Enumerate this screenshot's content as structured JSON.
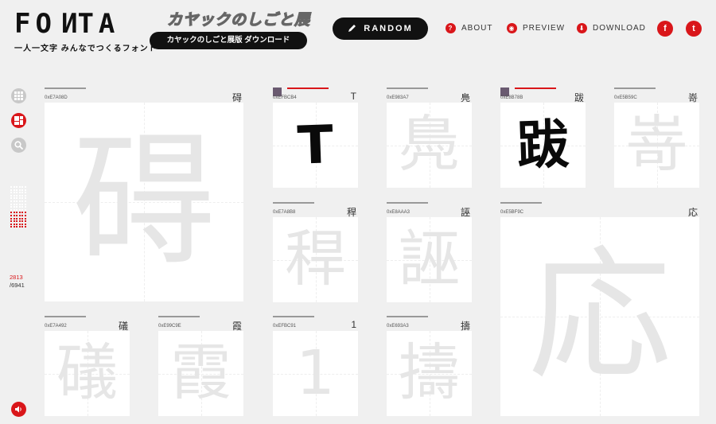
{
  "header": {
    "logo": "FONTA",
    "tagline": "一人一文字 みんなでつくるフォント",
    "event_title": "カヤックのしごと展",
    "event_button": "カヤックのしごと展版 ダウンロード",
    "random_label": "RANDOM",
    "random_icon": "pencil-icon",
    "nav": [
      {
        "label": "ABOUT",
        "icon": "question-icon",
        "glyph": "?"
      },
      {
        "label": "PREVIEW",
        "icon": "eye-icon",
        "glyph": "◉"
      },
      {
        "label": "DOWNLOAD",
        "icon": "download-icon",
        "glyph": "⬇"
      }
    ],
    "social": [
      {
        "name": "facebook-icon",
        "glyph": "f"
      },
      {
        "name": "twitter-icon",
        "glyph": "t"
      }
    ]
  },
  "rail": {
    "progress": {
      "done": 2813,
      "total": 6941,
      "done_label": "2813",
      "total_label": "/6941"
    }
  },
  "tiles": [
    {
      "code": "0xE7A08D",
      "char": "碍",
      "glyph": "碍",
      "hand": false,
      "avatar": false,
      "red": false
    },
    {
      "code": "0xEFBCB4",
      "char": "T",
      "glyph": "T",
      "hand": true,
      "avatar": true,
      "red": true
    },
    {
      "code": "0xE983A7",
      "char": "鳧",
      "glyph": "鳧",
      "hand": false,
      "avatar": false,
      "red": false
    },
    {
      "code": "0xE8B78B",
      "char": "跋",
      "glyph": "跋",
      "hand": true,
      "avatar": true,
      "red": true
    },
    {
      "code": "0xE5B59C",
      "char": "嵜",
      "glyph": "嵜",
      "hand": false,
      "avatar": false,
      "red": false
    },
    {
      "code": "0xE7A8B8",
      "char": "稈",
      "glyph": "稈",
      "hand": false,
      "avatar": false,
      "red": false
    },
    {
      "code": "0xE8AAA3",
      "char": "誣",
      "glyph": "誣",
      "hand": false,
      "avatar": false,
      "red": false
    },
    {
      "code": "0xE5BF9C",
      "char": "応",
      "glyph": "応",
      "hand": false,
      "avatar": false,
      "red": false
    },
    {
      "code": "0xE7A492",
      "char": "礒",
      "glyph": "礒",
      "hand": false,
      "avatar": false,
      "red": false
    },
    {
      "code": "0xE99C9E",
      "char": "霞",
      "glyph": "霞",
      "hand": false,
      "avatar": false,
      "red": false
    },
    {
      "code": "0xEFBC91",
      "char": "1",
      "glyph": "1",
      "hand": false,
      "avatar": false,
      "red": false
    },
    {
      "code": "0xE693A3",
      "char": "擣",
      "glyph": "擣",
      "hand": false,
      "avatar": false,
      "red": false
    }
  ]
}
